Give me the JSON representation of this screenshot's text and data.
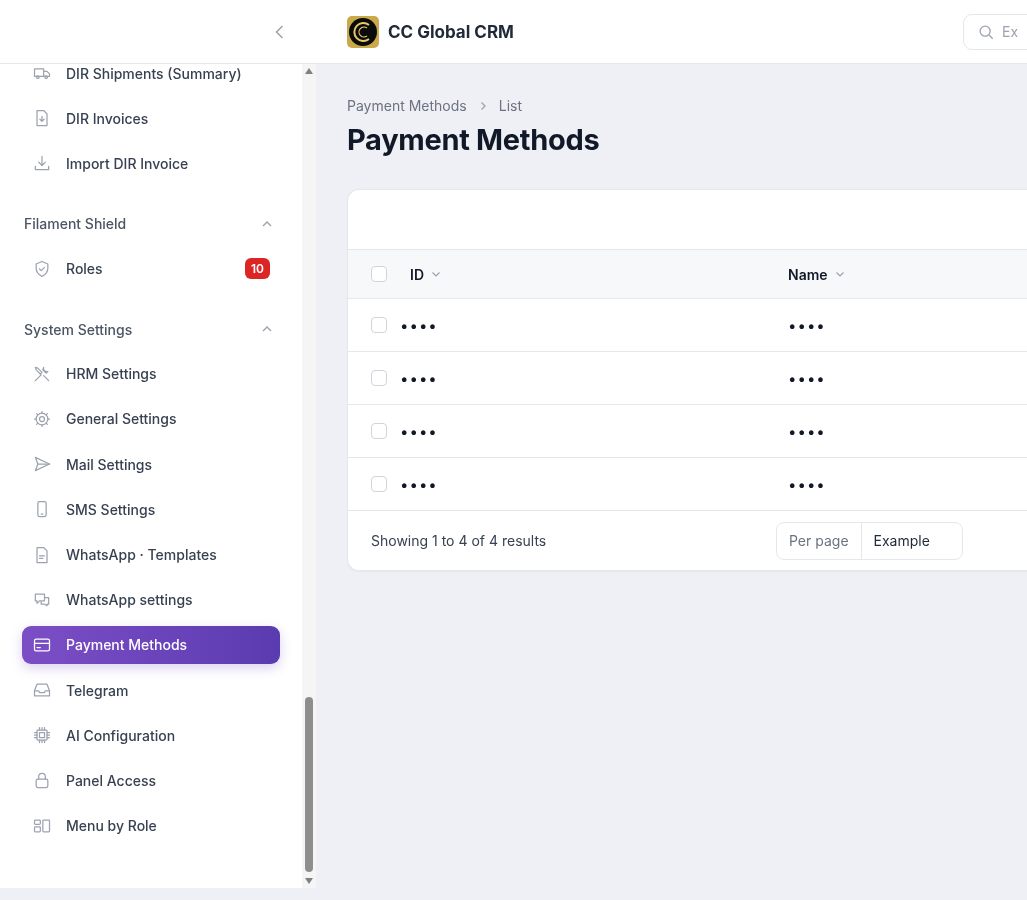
{
  "sidebar": {
    "items": [
      {
        "label": "DIR Shipments (Summary)",
        "selected": false
      },
      {
        "label": "DIR Invoices",
        "selected": false
      },
      {
        "label": "Import DIR Invoice",
        "selected": false
      }
    ],
    "groups": [
      {
        "label": "Filament Shield",
        "expanded": true,
        "items": [
          {
            "label": "Roles",
            "selected": false,
            "badge": "10"
          }
        ]
      },
      {
        "label": "System Settings",
        "expanded": true,
        "items": [
          {
            "label": "HRM Settings",
            "selected": false
          },
          {
            "label": "General Settings",
            "selected": false
          },
          {
            "label": "Mail Settings",
            "selected": false
          },
          {
            "label": "SMS Settings",
            "selected": false
          },
          {
            "label": "WhatsApp · Templates",
            "selected": false
          },
          {
            "label": "WhatsApp settings",
            "selected": false
          },
          {
            "label": "Payment Methods",
            "selected": true
          },
          {
            "label": "Telegram",
            "selected": false
          },
          {
            "label": "AI Configuration",
            "selected": false
          },
          {
            "label": "Panel Access",
            "selected": false
          },
          {
            "label": "Menu by Role",
            "selected": false
          }
        ]
      }
    ]
  },
  "topbar": {
    "brand": "CC Global CRM",
    "search": {
      "placeholder": "Ex"
    }
  },
  "breadcrumbs": [
    "Payment Methods",
    "List"
  ],
  "page_title": "Payment Methods",
  "table": {
    "select_all": {
      "checked": false
    },
    "columns": [
      "ID",
      "Name"
    ],
    "rows": [
      {
        "checked": false,
        "cells": [
          "••••",
          "••••"
        ]
      },
      {
        "checked": false,
        "cells": [
          "••••",
          "••••"
        ]
      },
      {
        "checked": false,
        "cells": [
          "••••",
          "••••"
        ]
      },
      {
        "checked": false,
        "cells": [
          "••••",
          "••••"
        ]
      }
    ],
    "summary": "Showing 1 to 4 of 4 results",
    "per_page": {
      "label": "Per page",
      "value": "Example"
    }
  }
}
